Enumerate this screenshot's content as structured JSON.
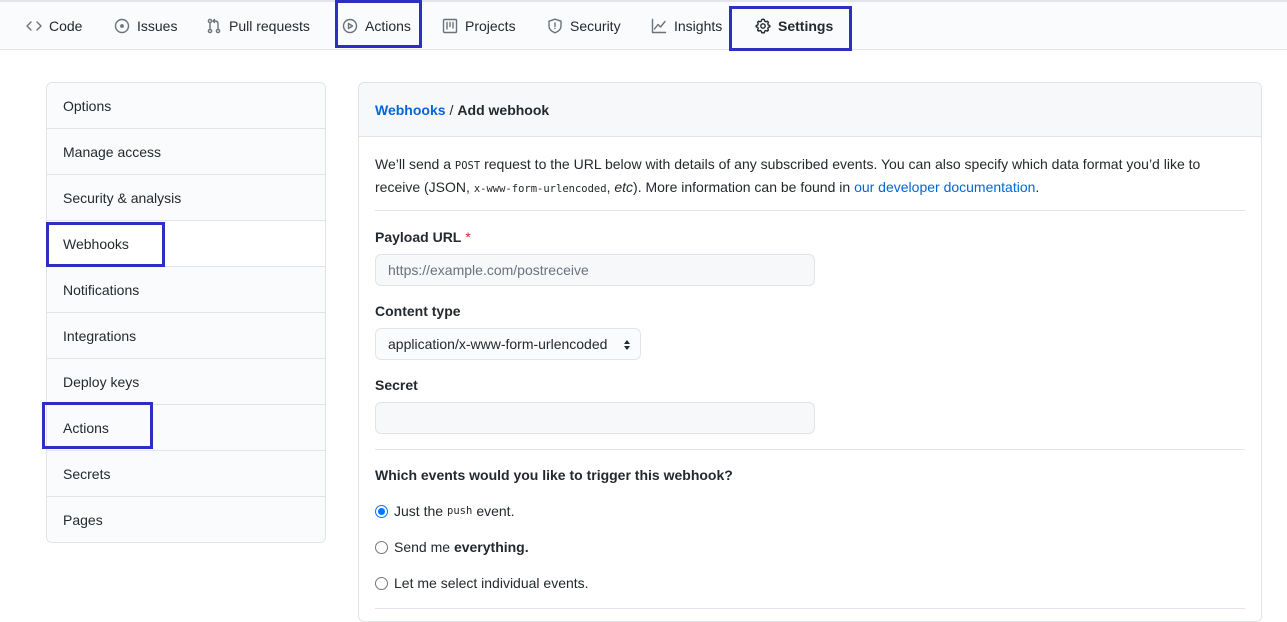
{
  "nav": {
    "tabs": [
      {
        "label": "Code",
        "icon": "code-icon"
      },
      {
        "label": "Issues",
        "icon": "issue-icon"
      },
      {
        "label": "Pull requests",
        "icon": "pull-request-icon"
      },
      {
        "label": "Actions",
        "icon": "play-icon"
      },
      {
        "label": "Projects",
        "icon": "project-icon"
      },
      {
        "label": "Security",
        "icon": "shield-icon"
      },
      {
        "label": "Insights",
        "icon": "graph-icon"
      },
      {
        "label": "Settings",
        "icon": "gear-icon"
      }
    ],
    "active": "Settings"
  },
  "sidebar": {
    "items": [
      {
        "label": "Options"
      },
      {
        "label": "Manage access"
      },
      {
        "label": "Security & analysis"
      },
      {
        "label": "Webhooks"
      },
      {
        "label": "Notifications"
      },
      {
        "label": "Integrations"
      },
      {
        "label": "Deploy keys"
      },
      {
        "label": "Actions"
      },
      {
        "label": "Secrets"
      },
      {
        "label": "Pages"
      }
    ],
    "selected": "Webhooks"
  },
  "breadcrumb": {
    "parent": "Webhooks",
    "separator": "/",
    "current": "Add webhook"
  },
  "intro": {
    "part1": "We’ll send a ",
    "code1": "POST",
    "part2": " request to the URL below with details of any subscribed events. You can also specify which data format you’d like to receive (JSON, ",
    "code2": "x-www-form-urlencoded",
    "part3": ", ",
    "etc": "etc",
    "part4": "). More information can be found in ",
    "link": "our developer documentation",
    "part5": "."
  },
  "form": {
    "payload_url": {
      "label": "Payload URL",
      "required_mark": "*",
      "placeholder": "https://example.com/postreceive",
      "value": ""
    },
    "content_type": {
      "label": "Content type",
      "selected": "application/x-www-form-urlencoded"
    },
    "secret": {
      "label": "Secret",
      "value": ""
    },
    "events": {
      "question": "Which events would you like to trigger this webhook?",
      "options": [
        {
          "prefix": "Just the",
          "code": "push",
          "suffix": "event.",
          "checked": true
        },
        {
          "prefix": "Send me",
          "bold": "everything.",
          "checked": false
        },
        {
          "prefix": "Let me select individual events.",
          "checked": false
        }
      ]
    }
  },
  "colors": {
    "accent": "#0366d6",
    "highlight": "#2d2fc4",
    "required": "#cb2431"
  }
}
